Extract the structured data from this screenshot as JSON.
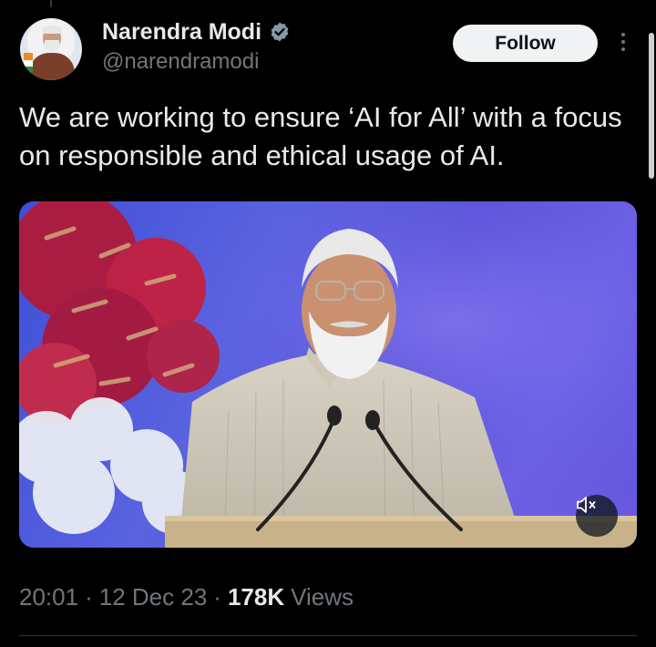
{
  "tweet": {
    "author": {
      "name": "Narendra Modi",
      "handle": "@narendramodi",
      "verified": true
    },
    "follow_label": "Follow",
    "text": "We are working to ensure ‘AI for All’ with a focus on responsible and ethical usage of AI.",
    "media": {
      "type": "video",
      "muted": true
    },
    "meta": {
      "time": "20:01",
      "date": "12 Dec 23",
      "views_count": "178K",
      "views_label": "Views"
    }
  },
  "colors": {
    "background": "#000000",
    "text_primary": "#e7e9ea",
    "text_secondary": "#71767b",
    "verified_badge": "#829aab",
    "follow_bg": "#eff3f4"
  },
  "icons": [
    "verified-badge-icon",
    "more-options-icon",
    "volume-muted-icon"
  ]
}
